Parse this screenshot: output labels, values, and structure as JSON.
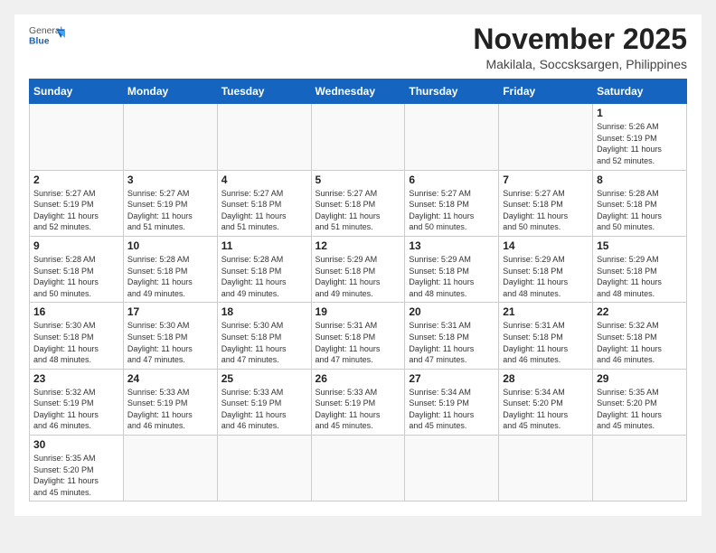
{
  "header": {
    "logo_general": "General",
    "logo_blue": "Blue",
    "month_year": "November 2025",
    "location": "Makilala, Soccsksargen, Philippines"
  },
  "weekdays": [
    "Sunday",
    "Monday",
    "Tuesday",
    "Wednesday",
    "Thursday",
    "Friday",
    "Saturday"
  ],
  "weeks": [
    [
      {
        "day": "",
        "info": ""
      },
      {
        "day": "",
        "info": ""
      },
      {
        "day": "",
        "info": ""
      },
      {
        "day": "",
        "info": ""
      },
      {
        "day": "",
        "info": ""
      },
      {
        "day": "",
        "info": ""
      },
      {
        "day": "1",
        "info": "Sunrise: 5:26 AM\nSunset: 5:19 PM\nDaylight: 11 hours\nand 52 minutes."
      }
    ],
    [
      {
        "day": "2",
        "info": "Sunrise: 5:27 AM\nSunset: 5:19 PM\nDaylight: 11 hours\nand 52 minutes."
      },
      {
        "day": "3",
        "info": "Sunrise: 5:27 AM\nSunset: 5:19 PM\nDaylight: 11 hours\nand 51 minutes."
      },
      {
        "day": "4",
        "info": "Sunrise: 5:27 AM\nSunset: 5:18 PM\nDaylight: 11 hours\nand 51 minutes."
      },
      {
        "day": "5",
        "info": "Sunrise: 5:27 AM\nSunset: 5:18 PM\nDaylight: 11 hours\nand 51 minutes."
      },
      {
        "day": "6",
        "info": "Sunrise: 5:27 AM\nSunset: 5:18 PM\nDaylight: 11 hours\nand 50 minutes."
      },
      {
        "day": "7",
        "info": "Sunrise: 5:27 AM\nSunset: 5:18 PM\nDaylight: 11 hours\nand 50 minutes."
      },
      {
        "day": "8",
        "info": "Sunrise: 5:28 AM\nSunset: 5:18 PM\nDaylight: 11 hours\nand 50 minutes."
      }
    ],
    [
      {
        "day": "9",
        "info": "Sunrise: 5:28 AM\nSunset: 5:18 PM\nDaylight: 11 hours\nand 50 minutes."
      },
      {
        "day": "10",
        "info": "Sunrise: 5:28 AM\nSunset: 5:18 PM\nDaylight: 11 hours\nand 49 minutes."
      },
      {
        "day": "11",
        "info": "Sunrise: 5:28 AM\nSunset: 5:18 PM\nDaylight: 11 hours\nand 49 minutes."
      },
      {
        "day": "12",
        "info": "Sunrise: 5:29 AM\nSunset: 5:18 PM\nDaylight: 11 hours\nand 49 minutes."
      },
      {
        "day": "13",
        "info": "Sunrise: 5:29 AM\nSunset: 5:18 PM\nDaylight: 11 hours\nand 48 minutes."
      },
      {
        "day": "14",
        "info": "Sunrise: 5:29 AM\nSunset: 5:18 PM\nDaylight: 11 hours\nand 48 minutes."
      },
      {
        "day": "15",
        "info": "Sunrise: 5:29 AM\nSunset: 5:18 PM\nDaylight: 11 hours\nand 48 minutes."
      }
    ],
    [
      {
        "day": "16",
        "info": "Sunrise: 5:30 AM\nSunset: 5:18 PM\nDaylight: 11 hours\nand 48 minutes."
      },
      {
        "day": "17",
        "info": "Sunrise: 5:30 AM\nSunset: 5:18 PM\nDaylight: 11 hours\nand 47 minutes."
      },
      {
        "day": "18",
        "info": "Sunrise: 5:30 AM\nSunset: 5:18 PM\nDaylight: 11 hours\nand 47 minutes."
      },
      {
        "day": "19",
        "info": "Sunrise: 5:31 AM\nSunset: 5:18 PM\nDaylight: 11 hours\nand 47 minutes."
      },
      {
        "day": "20",
        "info": "Sunrise: 5:31 AM\nSunset: 5:18 PM\nDaylight: 11 hours\nand 47 minutes."
      },
      {
        "day": "21",
        "info": "Sunrise: 5:31 AM\nSunset: 5:18 PM\nDaylight: 11 hours\nand 46 minutes."
      },
      {
        "day": "22",
        "info": "Sunrise: 5:32 AM\nSunset: 5:18 PM\nDaylight: 11 hours\nand 46 minutes."
      }
    ],
    [
      {
        "day": "23",
        "info": "Sunrise: 5:32 AM\nSunset: 5:19 PM\nDaylight: 11 hours\nand 46 minutes."
      },
      {
        "day": "24",
        "info": "Sunrise: 5:33 AM\nSunset: 5:19 PM\nDaylight: 11 hours\nand 46 minutes."
      },
      {
        "day": "25",
        "info": "Sunrise: 5:33 AM\nSunset: 5:19 PM\nDaylight: 11 hours\nand 46 minutes."
      },
      {
        "day": "26",
        "info": "Sunrise: 5:33 AM\nSunset: 5:19 PM\nDaylight: 11 hours\nand 45 minutes."
      },
      {
        "day": "27",
        "info": "Sunrise: 5:34 AM\nSunset: 5:19 PM\nDaylight: 11 hours\nand 45 minutes."
      },
      {
        "day": "28",
        "info": "Sunrise: 5:34 AM\nSunset: 5:20 PM\nDaylight: 11 hours\nand 45 minutes."
      },
      {
        "day": "29",
        "info": "Sunrise: 5:35 AM\nSunset: 5:20 PM\nDaylight: 11 hours\nand 45 minutes."
      }
    ],
    [
      {
        "day": "30",
        "info": "Sunrise: 5:35 AM\nSunset: 5:20 PM\nDaylight: 11 hours\nand 45 minutes."
      },
      {
        "day": "",
        "info": ""
      },
      {
        "day": "",
        "info": ""
      },
      {
        "day": "",
        "info": ""
      },
      {
        "day": "",
        "info": ""
      },
      {
        "day": "",
        "info": ""
      },
      {
        "day": "",
        "info": ""
      }
    ]
  ]
}
